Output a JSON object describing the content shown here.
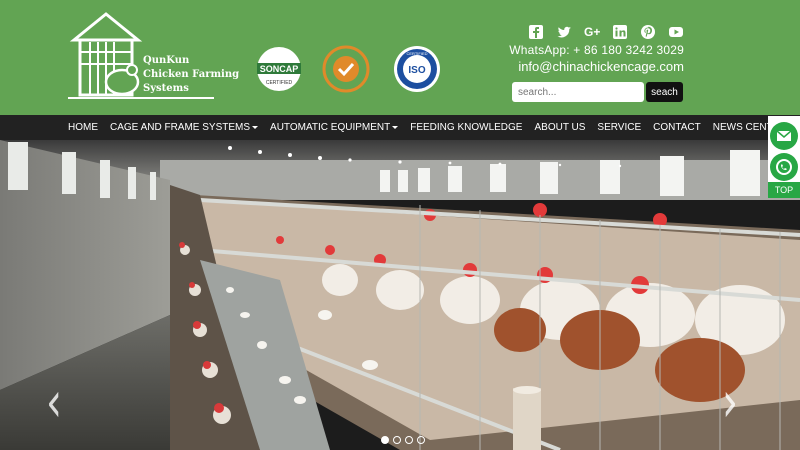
{
  "header": {
    "logo": {
      "line1": "QunKun",
      "line2": "Chicken Farming",
      "line3": "Systems"
    },
    "badges": {
      "soncap": "SONCAP",
      "soncap_sub": "CERTIFIED",
      "iso": "ISO",
      "iso_sub": "CERTIFIED"
    },
    "social_icons": [
      "facebook-icon",
      "twitter-icon",
      "google-plus-icon",
      "linkedin-icon",
      "pinterest-icon",
      "youtube-icon"
    ],
    "whatsapp": "WhatsApp: + 86 180 3242 3029",
    "email": "info@chinachickencage.com",
    "search_placeholder": "search...",
    "search_button": "seach"
  },
  "nav": {
    "items": [
      {
        "label": "HOME"
      },
      {
        "label": "CAGE AND FRAME SYSTEMS"
      },
      {
        "label": "AUTOMATIC EQUIPMENT"
      },
      {
        "label": "FEEDING KNOWLEDGE"
      },
      {
        "label": "ABOUT US"
      },
      {
        "label": "SERVICE"
      },
      {
        "label": "CONTACT"
      },
      {
        "label": "NEWS CENTER"
      }
    ]
  },
  "floating": {
    "top_label": "TOP"
  },
  "carousel": {
    "slides": 4,
    "active": 0
  },
  "colors": {
    "header_green": "#62a453",
    "nav_dark": "#222222",
    "float_green": "#28a745"
  }
}
